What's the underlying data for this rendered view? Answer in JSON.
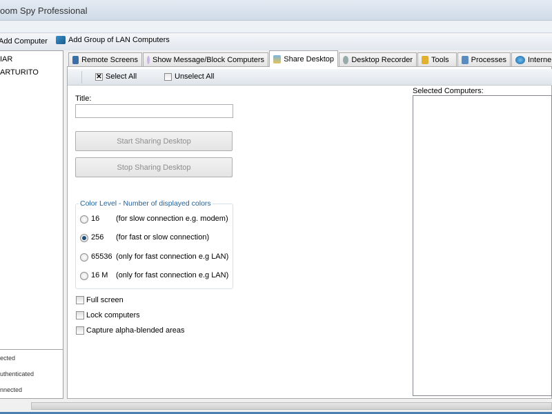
{
  "window": {
    "title": "oom Spy Professional"
  },
  "toolbar": {
    "add_computer": "Add Computer",
    "add_group": "Add Group of LAN Computers"
  },
  "computers": [
    "IAR",
    "ARTURITO"
  ],
  "legend": [
    "ected",
    "uthenticated",
    "nnected"
  ],
  "tabs": [
    {
      "label": "Remote Screens",
      "icon": "monitor-icon"
    },
    {
      "label": "Show Message/Block Computers",
      "icon": "message-icon"
    },
    {
      "label": "Share Desktop",
      "icon": "share-desktop-icon",
      "active": true
    },
    {
      "label": "Desktop Recorder",
      "icon": "recorder-icon"
    },
    {
      "label": "Tools",
      "icon": "drill-icon"
    },
    {
      "label": "Processes",
      "icon": "processes-icon"
    },
    {
      "label": "Interne",
      "icon": "globe-icon"
    }
  ],
  "inner_toolbar": {
    "select_all": "Select All",
    "unselect_all": "Unselect All"
  },
  "share": {
    "title_label": "Title:",
    "title_value": "",
    "start_button": "Start Sharing Desktop",
    "stop_button": "Stop Sharing Desktop",
    "color_group_label": "Color Level - Number of displayed colors",
    "color_options": [
      {
        "value": "16",
        "desc": "(for slow connection e.g. modem)",
        "selected": false
      },
      {
        "value": "256",
        "desc": "(for fast or slow connection)",
        "selected": true
      },
      {
        "value": "65536",
        "desc": "(only for fast connection e.g LAN)",
        "selected": false
      },
      {
        "value": "16 M",
        "desc": "(only for fast connection e.g LAN)",
        "selected": false
      }
    ],
    "checkboxes": [
      {
        "label": "Full screen",
        "checked": false
      },
      {
        "label": "Lock computers",
        "checked": false
      },
      {
        "label": "Capture alpha-blended areas",
        "checked": false
      }
    ],
    "selected_computers_label": "Selected Computers:"
  },
  "colors": {
    "accent": "#1e5f9a",
    "title_bar": "#dbe4ee",
    "bottom_line": "#4a7fb0"
  }
}
